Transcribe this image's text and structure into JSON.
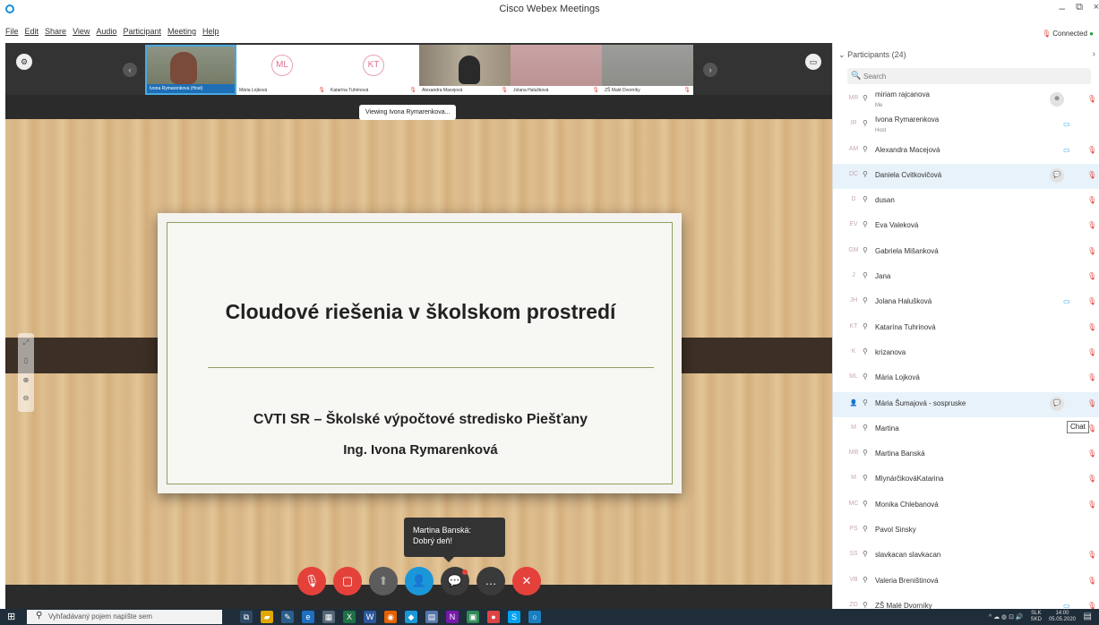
{
  "window": {
    "title": "Cisco Webex Meetings",
    "minimize": "–",
    "maximize": "⧉",
    "close": "×"
  },
  "menu": [
    "File",
    "Edit",
    "Share",
    "View",
    "Audio",
    "Participant",
    "Meeting",
    "Help"
  ],
  "status": {
    "connected": "Connected"
  },
  "filmstrip": {
    "tiles": [
      {
        "name": "Ivona Rymarenkova (Host)",
        "initials": ""
      },
      {
        "name": "Mária Lojková",
        "initials": "ML"
      },
      {
        "name": "Katarína Tuhrinová",
        "initials": "KT"
      },
      {
        "name": "Alexandra Macejová",
        "initials": ""
      },
      {
        "name": "Jolana Halušková",
        "initials": ""
      },
      {
        "name": "ZŠ Malé Dvorníky",
        "initials": ""
      }
    ]
  },
  "viewing": "Viewing Ivona Rymarenkova...",
  "slide": {
    "title": "Cloudové riešenia v školskom prostredí",
    "subtitle": "CVTI SR – Školské výpočtové stredisko Piešťany",
    "author": "Ing. Ivona Rymarenková"
  },
  "toast": {
    "sender": "Martina Banská:",
    "message": "Dobrý deň!"
  },
  "controls": {
    "mute": "🎙",
    "video": "▢",
    "share": "⬆",
    "participants": "👤",
    "chat": "💬",
    "more": "…",
    "end": "✕"
  },
  "panel": {
    "header": "Participants (24)",
    "search_placeholder": "Search",
    "participants": [
      {
        "initials": "MR",
        "name": "miriam rajcanova",
        "role": "Me",
        "cam": false,
        "mic": true,
        "chat": "⊕",
        "hl": false
      },
      {
        "initials": "IR",
        "name": "Ivona Rymarenkova",
        "role": "Host",
        "cam": true,
        "mic": false,
        "hl": false
      },
      {
        "initials": "AM",
        "name": "Alexandra Macejová",
        "role": "",
        "cam": true,
        "mic": true,
        "hl": false
      },
      {
        "initials": "DC",
        "name": "Daniela Cvitkovičová",
        "role": "",
        "cam": false,
        "mic": true,
        "chat": "💬",
        "hl": true
      },
      {
        "initials": "D",
        "name": "dusan",
        "role": "",
        "cam": false,
        "mic": true,
        "hl": false
      },
      {
        "initials": "EV",
        "name": "Eva Valeková",
        "role": "",
        "cam": false,
        "mic": true,
        "hl": false
      },
      {
        "initials": "GM",
        "name": "Gabriela Mišanková",
        "role": "",
        "cam": false,
        "mic": true,
        "hl": false
      },
      {
        "initials": "J",
        "name": "Jana",
        "role": "",
        "cam": false,
        "mic": true,
        "hl": false
      },
      {
        "initials": "JH",
        "name": "Jolana Halušková",
        "role": "",
        "cam": true,
        "mic": true,
        "hl": false
      },
      {
        "initials": "KT",
        "name": "Katarína Tuhrinová",
        "role": "",
        "cam": false,
        "mic": true,
        "hl": false
      },
      {
        "initials": "K",
        "name": "krizanova",
        "role": "",
        "cam": false,
        "mic": true,
        "hl": false
      },
      {
        "initials": "ML",
        "name": "Mária Lojková",
        "role": "",
        "cam": false,
        "mic": true,
        "hl": false
      },
      {
        "initials": "",
        "name": "Mária Šumajová - sospruske",
        "role": "",
        "cam": false,
        "mic": true,
        "chat": "💬",
        "hl": true
      },
      {
        "initials": "M",
        "name": "Martina",
        "role": "",
        "cam": false,
        "mic": true,
        "hl": false
      },
      {
        "initials": "MB",
        "name": "Martina Banská",
        "role": "",
        "cam": false,
        "mic": true,
        "hl": false
      },
      {
        "initials": "M",
        "name": "MlynárčikováKatarina",
        "role": "",
        "cam": false,
        "mic": true,
        "hl": false
      },
      {
        "initials": "MC",
        "name": "Monika Chlebanová",
        "role": "",
        "cam": false,
        "mic": true,
        "hl": false
      },
      {
        "initials": "PS",
        "name": "Pavol Sinsky",
        "role": "",
        "cam": false,
        "mic": false,
        "hl": false
      },
      {
        "initials": "SS",
        "name": "slavkacan slavkacan",
        "role": "",
        "cam": false,
        "mic": true,
        "hl": false
      },
      {
        "initials": "VB",
        "name": "Valeria Breništinová",
        "role": "",
        "cam": false,
        "mic": true,
        "hl": false
      },
      {
        "initials": "ZD",
        "name": "ZŠ Malé Dvorníky",
        "role": "",
        "cam": true,
        "mic": true,
        "hl": false
      }
    ],
    "chat_tooltip": "Chat"
  },
  "taskbar": {
    "search_placeholder": "Vyhľadávaný pojem napíšte sem",
    "lang_top": "SLK",
    "lang_bottom": "SKD",
    "time": "14:00",
    "date": "05.05.2020"
  },
  "colors": {
    "accent": "#1a97d8",
    "danger": "#e5413b",
    "stage": "#2b2b2b",
    "taskbar": "#1f2d3a"
  }
}
